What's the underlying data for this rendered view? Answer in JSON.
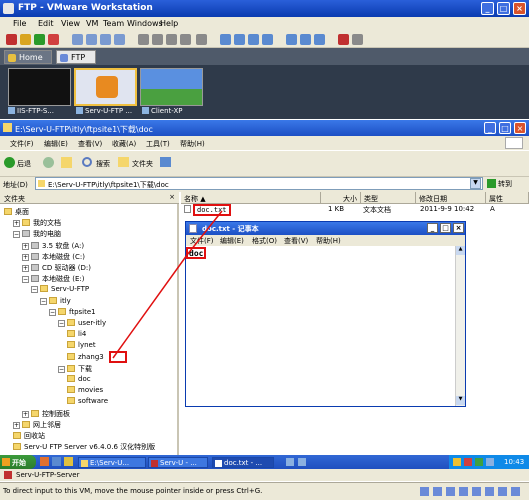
{
  "vmware": {
    "title": "FTP - VMware Workstation",
    "menu": [
      "File",
      "Edit",
      "View",
      "VM",
      "Team",
      "Windows",
      "Help"
    ],
    "tabs": [
      "Home",
      "FTP"
    ],
    "thumbnails": [
      "IIS-FTP-S...",
      "Serv-U-FTP ...",
      "Client-XP"
    ],
    "status": "To direct input to this VM, move the mouse pointer inside or press Ctrl+G."
  },
  "explorer": {
    "title": "E:\\Serv-U-FTP\\itly\\ftpsite1\\下载\\doc",
    "menu": [
      "文件(F)",
      "编辑(E)",
      "查看(V)",
      "收藏(A)",
      "工具(T)",
      "帮助(H)"
    ],
    "back": "后退",
    "search": "搜索",
    "folders": "文件夹",
    "address_label": "地址(D)",
    "address": "E:\\Serv-U-FTP\\itly\\ftpsite1\\下载\\doc",
    "go": "转到",
    "tree_header": "文件夹",
    "tree": [
      {
        "label": "桌面",
        "indent": 0,
        "pm": "",
        "kind": "desk"
      },
      {
        "label": "我的文档",
        "indent": 1,
        "pm": "+",
        "kind": "fold"
      },
      {
        "label": "我的电脑",
        "indent": 1,
        "pm": "−",
        "kind": "pc"
      },
      {
        "label": "3.5 软盘 (A:)",
        "indent": 2,
        "pm": "+",
        "kind": "drv"
      },
      {
        "label": "本地磁盘 (C:)",
        "indent": 2,
        "pm": "+",
        "kind": "drv"
      },
      {
        "label": "CD 驱动器 (D:)",
        "indent": 2,
        "pm": "+",
        "kind": "drv"
      },
      {
        "label": "本地磁盘 (E:)",
        "indent": 2,
        "pm": "−",
        "kind": "drv"
      },
      {
        "label": "Serv-U-FTP",
        "indent": 3,
        "pm": "−",
        "kind": "fold"
      },
      {
        "label": "itly",
        "indent": 4,
        "pm": "−",
        "kind": "fold"
      },
      {
        "label": "ftpsite1",
        "indent": 5,
        "pm": "−",
        "kind": "fold"
      },
      {
        "label": "user-itly",
        "indent": 6,
        "pm": "−",
        "kind": "fold"
      },
      {
        "label": "li4",
        "indent": 7,
        "pm": "",
        "kind": "fold"
      },
      {
        "label": "lynet",
        "indent": 7,
        "pm": "",
        "kind": "fold"
      },
      {
        "label": "zhang3",
        "indent": 7,
        "pm": "",
        "kind": "fold"
      },
      {
        "label": "下载",
        "indent": 6,
        "pm": "−",
        "kind": "fold"
      },
      {
        "label": "doc",
        "indent": 7,
        "pm": "",
        "kind": "fold"
      },
      {
        "label": "movies",
        "indent": 7,
        "pm": "",
        "kind": "fold"
      },
      {
        "label": "software",
        "indent": 7,
        "pm": "",
        "kind": "fold"
      },
      {
        "label": "控制面板",
        "indent": 2,
        "pm": "+",
        "kind": "fold"
      },
      {
        "label": "网上邻居",
        "indent": 1,
        "pm": "+",
        "kind": "fold"
      },
      {
        "label": "回收站",
        "indent": 1,
        "pm": "",
        "kind": "fold"
      },
      {
        "label": "Serv-U FTP Server v6.4.0.6 汉化特别版",
        "indent": 1,
        "pm": "",
        "kind": "fold"
      }
    ],
    "columns": [
      "名称 ▲",
      "大小",
      "类型",
      "修改日期",
      "属性"
    ],
    "files": [
      {
        "name": "doc.txt",
        "size": "1 KB",
        "type": "文本文档",
        "date": "2011-9-9 10:42",
        "attr": "A"
      }
    ]
  },
  "notepad": {
    "title": "doc.txt - 记事本",
    "menu": [
      "文件(F)",
      "编辑(E)",
      "格式(O)",
      "查看(V)",
      "帮助(H)"
    ],
    "content": "doc"
  },
  "taskbar": {
    "start": "开始",
    "tasks": [
      "E:\\Serv-U...",
      "Serv-U - ...",
      "doc.txt - ..."
    ],
    "clock": "10:43",
    "row2": "Serv-U-FTP-Server"
  }
}
